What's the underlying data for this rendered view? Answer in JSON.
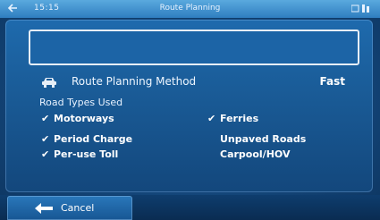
{
  "status_bar": {
    "time": "15:15",
    "title": "Route Planning"
  },
  "route_summary": {
    "value": ""
  },
  "route_method": {
    "label": "Route Planning Method",
    "value": "Fast",
    "icon": "car-icon"
  },
  "road_types": {
    "title": "Road Types Used",
    "left_column": [
      {
        "label": "Motorways",
        "checked": true
      },
      {
        "label": "Period Charge",
        "checked": true
      },
      {
        "label": "Per-use Toll",
        "checked": true
      }
    ],
    "right_column": [
      {
        "label": "Ferries",
        "checked": true
      },
      {
        "label": "Unpaved Roads",
        "checked": false
      },
      {
        "label": "Carpool/HOV",
        "checked": false
      }
    ]
  },
  "footer": {
    "cancel_label": "Cancel",
    "cancel_icon": "arrow-left-icon"
  },
  "colors": {
    "background": "#154a80",
    "status_bar": "#3f8fd0",
    "text": "#ffffff"
  }
}
